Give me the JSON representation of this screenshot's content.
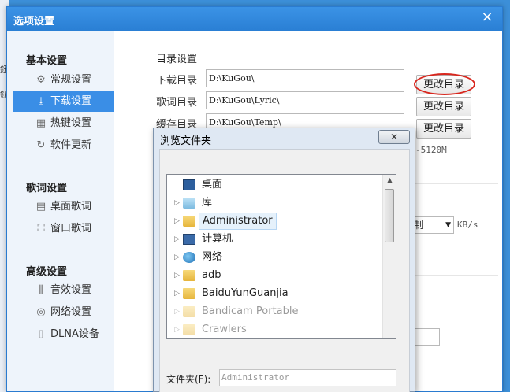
{
  "background": {
    "fragments": [
      "鈕",
      "鈕"
    ]
  },
  "dialog": {
    "title": "选项设置",
    "close_glyph": "×"
  },
  "sidebar": {
    "sections": [
      {
        "title": "基本设置",
        "items": [
          {
            "label": "常规设置",
            "icon": "gear-icon",
            "glyph": "⚙",
            "active": false
          },
          {
            "label": "下载设置",
            "icon": "download-icon",
            "glyph": "⤓",
            "active": true
          },
          {
            "label": "热键设置",
            "icon": "keyboard-icon",
            "glyph": "▦",
            "active": false
          },
          {
            "label": "软件更新",
            "icon": "update-icon",
            "glyph": "↻",
            "active": false
          }
        ]
      },
      {
        "title": "歌词设置",
        "items": [
          {
            "label": "桌面歌词",
            "icon": "desktop-lyrics-icon",
            "glyph": "▤",
            "active": false
          },
          {
            "label": "窗口歌词",
            "icon": "window-lyrics-icon",
            "glyph": "⛶",
            "active": false
          }
        ]
      },
      {
        "title": "高级设置",
        "items": [
          {
            "label": "音效设置",
            "icon": "equalizer-icon",
            "glyph": "⫼",
            "active": false
          },
          {
            "label": "网络设置",
            "icon": "network-icon",
            "glyph": "◎",
            "active": false
          },
          {
            "label": "DLNA设备",
            "icon": "device-icon",
            "glyph": "▯",
            "active": false
          }
        ]
      }
    ]
  },
  "content": {
    "heading": "目录设置",
    "rows": [
      {
        "label": "下载目录",
        "path": "D:\\KuGou\\",
        "button": "更改目录"
      },
      {
        "label": "歌词目录",
        "path": "D:\\KuGou\\Lyric\\",
        "button": "更改目录"
      },
      {
        "label": "缓存目录",
        "path": "D:\\KuGou\\Temp\\",
        "button": "更改目录"
      }
    ],
    "cache_range_fragment": "-5120M",
    "speed_select_fragment": "制",
    "speed_unit": "KB/s",
    "highlight_color": "#d8261d"
  },
  "browse": {
    "title": "浏览文件夹",
    "close_glyph": "✕",
    "tree": [
      {
        "label": "桌面",
        "icon": "desktop-icon",
        "expandable": false,
        "selected": false,
        "faded": false
      },
      {
        "label": "库",
        "icon": "library-icon",
        "expandable": true,
        "selected": false,
        "faded": false
      },
      {
        "label": "Administrator",
        "icon": "user-folder-icon",
        "expandable": true,
        "selected": true,
        "faded": false
      },
      {
        "label": "计算机",
        "icon": "computer-icon",
        "expandable": true,
        "selected": false,
        "faded": false
      },
      {
        "label": "网络",
        "icon": "network-globe-icon",
        "expandable": true,
        "selected": false,
        "faded": false
      },
      {
        "label": "adb",
        "icon": "folder-icon",
        "expandable": true,
        "selected": false,
        "faded": false
      },
      {
        "label": "BaiduYunGuanjia",
        "icon": "folder-icon",
        "expandable": true,
        "selected": false,
        "faded": false
      },
      {
        "label": "Bandicam Portable",
        "icon": "folder-icon",
        "expandable": true,
        "selected": false,
        "faded": true
      },
      {
        "label": "Crawlers",
        "icon": "folder-icon",
        "expandable": true,
        "selected": false,
        "faded": true
      }
    ],
    "folder_label": "文件夹(F):",
    "folder_value": "Administrator"
  }
}
